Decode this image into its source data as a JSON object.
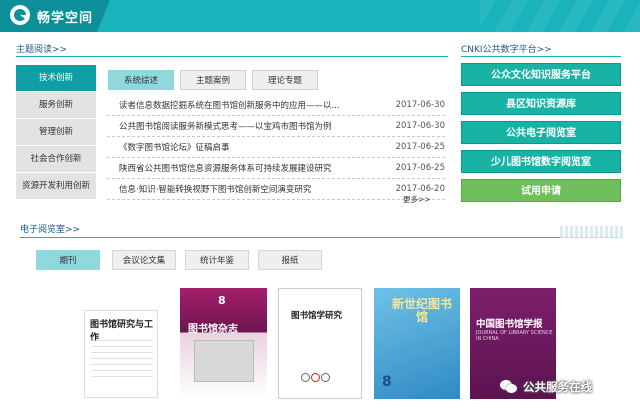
{
  "header": {
    "title": "畅学空间"
  },
  "reading": {
    "title": "主题阅读>>",
    "nav": [
      "技术创新",
      "服务创新",
      "管理创新",
      "社会合作创新",
      "资源开发利用创新"
    ],
    "tabs": [
      "系统综述",
      "主题案例",
      "理论专题"
    ],
    "articles": [
      {
        "title": "读者信息数据挖掘系统在图书馆创新服务中的应用——以...",
        "date": "2017-06-30"
      },
      {
        "title": "公共图书馆阅读服务新模式思考——以宝鸡市图书馆为例",
        "date": "2017-06-30"
      },
      {
        "title": "《数字图书馆论坛》征稿启事",
        "date": "2017-06-25"
      },
      {
        "title": "陕西省公共图书馆信息资源服务体系可持续发展建设研究",
        "date": "2017-06-25"
      },
      {
        "title": "信息·知识·智能转换视野下图书馆创新空间演变研究",
        "date": "2017-06-20"
      }
    ],
    "more": "更多>>"
  },
  "cnki": {
    "title": "CNKI公共数字平台>>",
    "buttons": [
      "公众文化知识服务平台",
      "县区知识资源库",
      "公共电子阅览室",
      "少儿图书馆数字阅览室",
      "试用申请"
    ]
  },
  "ereading": {
    "title": "电子阅览室>>",
    "tabs": [
      "期刊",
      "会议论文集",
      "统计年鉴",
      "报纸"
    ],
    "covers": [
      {
        "title": "图书馆研究与工作"
      },
      {
        "title": "图书馆杂志",
        "num": "8"
      },
      {
        "title": "图书馆学研究"
      },
      {
        "title": "新世纪图书馆",
        "num": "8"
      },
      {
        "title": "中国图书馆学报",
        "sub": "JOURNAL OF LIBRARY SCIENCE IN CHINA"
      }
    ]
  },
  "watermark": "公共服务在线",
  "colors": {
    "header": "#18b3bb",
    "accent": "#109ea6",
    "button": "#19b3a6",
    "trial": "#6fbf5c"
  }
}
